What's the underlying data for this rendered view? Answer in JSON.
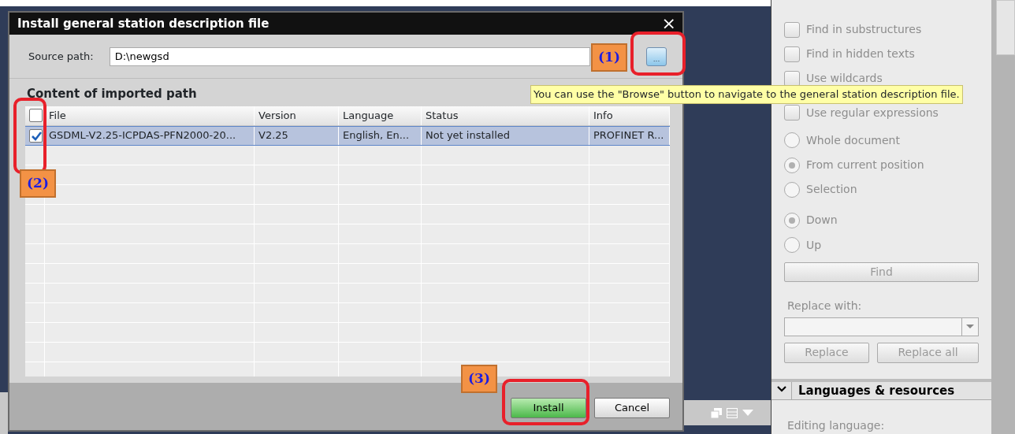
{
  "dialog": {
    "title": "Install general station description file",
    "close": "×",
    "source_label": "Source path:",
    "source_value": "D:\\newgsd",
    "browse_label": "...",
    "section_title": "Content of imported path",
    "table": {
      "select_all_checked": false,
      "columns": [
        "File",
        "Version",
        "Language",
        "Status",
        "Info"
      ],
      "rows": [
        {
          "checked": true,
          "selected": true,
          "cells": [
            "GSDML-V2.25-ICPDAS-PFN2000-20...",
            "V2.25",
            "English, En...",
            "Not yet installed",
            "PROFINET R..."
          ]
        }
      ]
    },
    "buttons": [
      {
        "label": "Install",
        "kind": "primary"
      },
      {
        "label": "Cancel",
        "kind": "secondary"
      }
    ]
  },
  "tooltip": "You can use the \"Browse\" button to navigate to the general station description file.",
  "callouts": [
    "(1)",
    "(2)",
    "(3)"
  ],
  "find_panel": {
    "options": [
      {
        "kind": "checkbox",
        "label": "Find in substructures",
        "checked": false
      },
      {
        "kind": "checkbox",
        "label": "Find in hidden texts",
        "checked": false
      },
      {
        "kind": "checkbox",
        "label": "Use wildcards",
        "checked": false
      },
      {
        "kind": "checkbox",
        "label": "Use regular expressions",
        "checked": false
      },
      {
        "kind": "radio",
        "label": "Whole document",
        "selected": false
      },
      {
        "kind": "radio",
        "label": "From current position",
        "selected": true
      },
      {
        "kind": "radio",
        "label": "Selection",
        "selected": false
      },
      {
        "kind": "radio",
        "label": "Down",
        "selected": true
      },
      {
        "kind": "radio",
        "label": "Up",
        "selected": false
      }
    ],
    "find_button": "Find",
    "replace_label": "Replace with:",
    "replace_buttons": [
      "Replace",
      "Replace all"
    ],
    "section": {
      "title": "Languages & resources",
      "expanded": true
    },
    "editing_language_label": "Editing language:"
  }
}
